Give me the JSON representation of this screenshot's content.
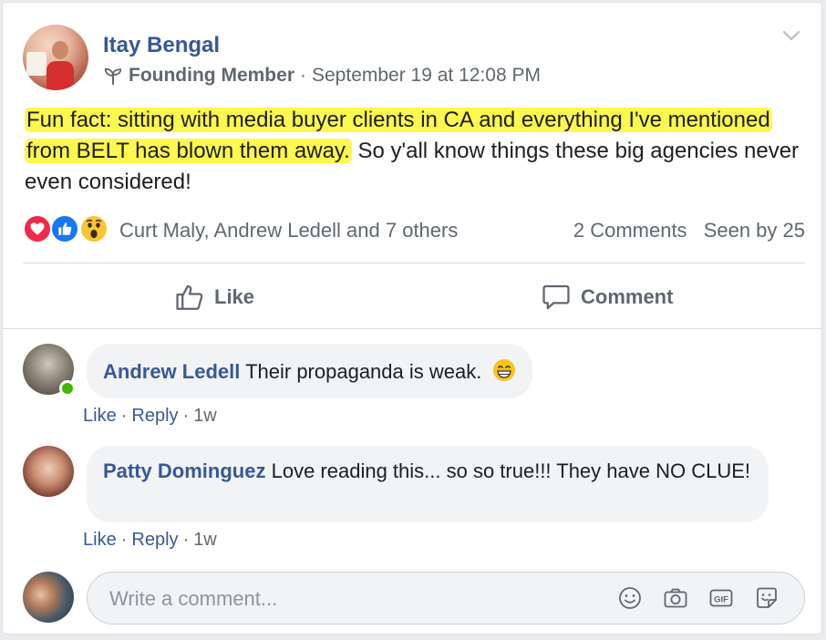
{
  "post": {
    "author": "Itay Bengal",
    "badge": "Founding Member",
    "separator": "·",
    "timestamp": "September 19 at 12:08 PM",
    "text_highlight_1": "Fun fact: sitting with media buyer clients in CA and everything I've mentioned from BELT has blown them away.",
    "text_rest": " So y'all know things these big agencies never even considered!",
    "highlight_color": "#fcf84d"
  },
  "reactions": {
    "icons": [
      "love-icon",
      "like-icon",
      "wow-icon"
    ],
    "names": "Curt Maly, Andrew Ledell and 7 others",
    "comments_count": "2 Comments",
    "seen_by": "Seen by 25"
  },
  "actions": {
    "like": "Like",
    "comment": "Comment"
  },
  "comments": [
    {
      "author": "Andrew Ledell",
      "text": "Their propaganda is weak.",
      "emoji": "grinning-face-icon",
      "online": true,
      "like": "Like",
      "reply": "Reply",
      "sep": "·",
      "age": "1w"
    },
    {
      "author": "Patty Dominguez",
      "text": "Love reading this... so so true!!! They have NO CLUE!",
      "like": "Like",
      "reply": "Reply",
      "sep": "·",
      "age": "1w"
    }
  ],
  "composer": {
    "placeholder": "Write a comment...",
    "tools": [
      "emoji-icon",
      "camera-icon",
      "gif-icon",
      "sticker-icon"
    ]
  },
  "colors": {
    "link": "#365899",
    "secondary_text": "#606770",
    "bubble": "#f2f3f5",
    "online": "#44b700"
  }
}
